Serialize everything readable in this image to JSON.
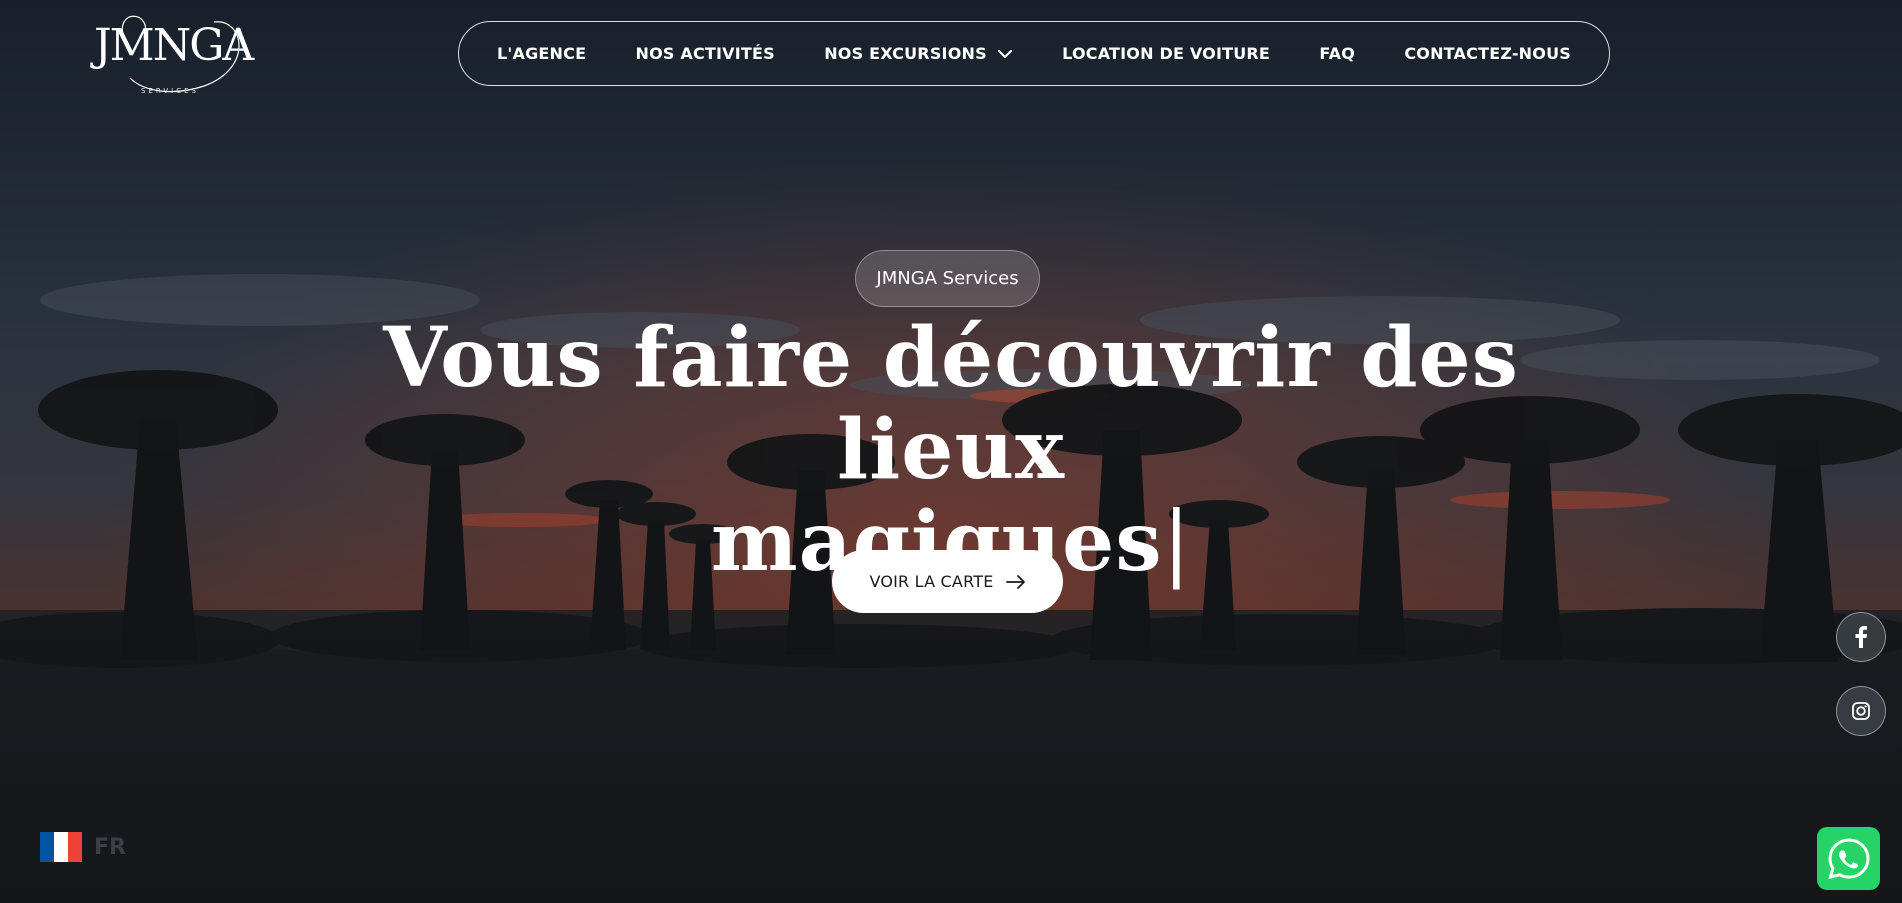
{
  "brand": {
    "logo_text": "JMNGA",
    "logo_subtitle": "SERVICES"
  },
  "nav": {
    "items": [
      {
        "label": "L'AGENCE"
      },
      {
        "label": "NOS ACTIVITÉS"
      },
      {
        "label": "NOS EXCURSIONS",
        "has_dropdown": true
      },
      {
        "label": "LOCATION DE VOITURE"
      },
      {
        "label": "FAQ"
      },
      {
        "label": "CONTACTEZ-NOUS"
      }
    ]
  },
  "hero": {
    "badge": "JMNGA Services",
    "headline_line1": "Vous faire découvrir des lieux",
    "headline_line2": "magiques",
    "caret": "|",
    "cta_label": "VOIR LA CARTE",
    "cta_icon": "arrow-right-icon"
  },
  "social": [
    {
      "name": "facebook",
      "icon": "facebook-icon"
    },
    {
      "name": "instagram",
      "icon": "instagram-icon"
    }
  ],
  "language": {
    "code": "FR",
    "flag": "france-flag-icon",
    "flag_colors": [
      "#0055a4",
      "#ffffff",
      "#ef4135"
    ]
  },
  "whatsapp": {
    "icon": "whatsapp-icon",
    "color": "#25d366"
  },
  "colors": {
    "sky_dark": "#1c2530",
    "sunset": "#c0502f",
    "text": "#ffffff"
  }
}
